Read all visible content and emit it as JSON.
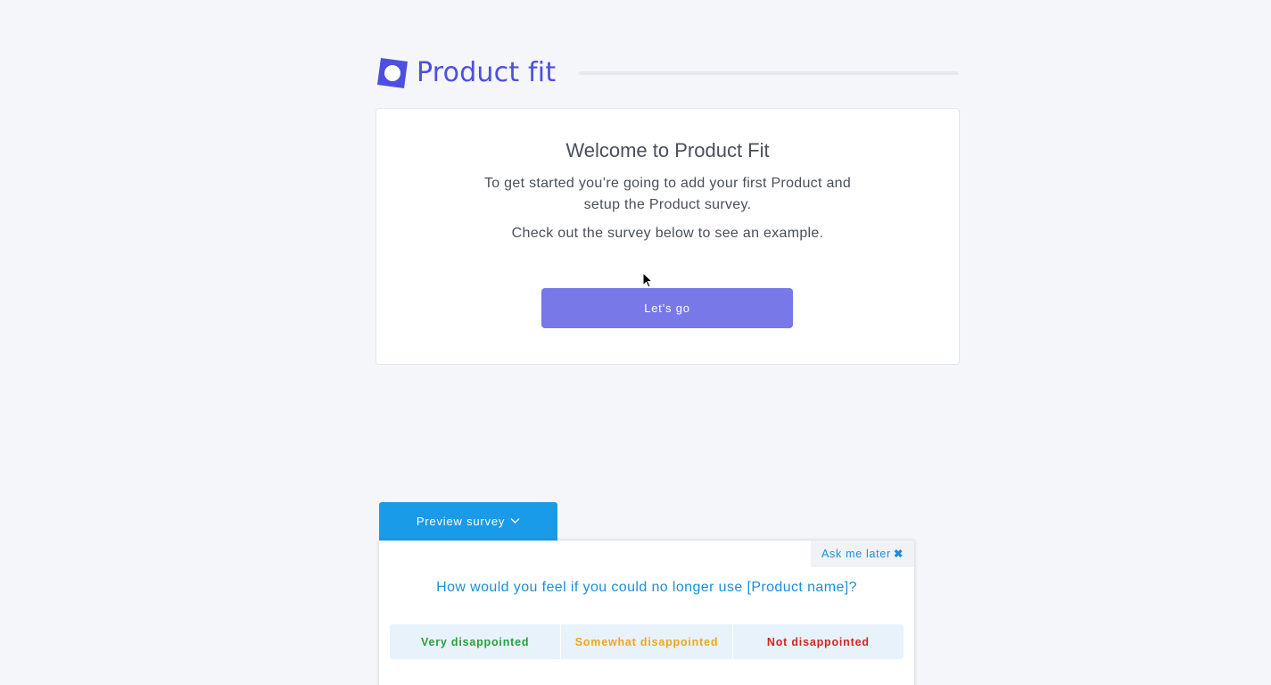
{
  "brand": {
    "name": "Product fit",
    "logo_icon": "product-fit-logo-icon",
    "color": "#4e4ee0"
  },
  "progress": {
    "value": 0.0
  },
  "welcome": {
    "title": "Welcome to Product Fit",
    "text": "To get started you’re going to add your first Product and setup the Product survey.",
    "text2": "Check out the survey below to see an example.",
    "button_label": "Let's go",
    "button_color": "#7878e8"
  },
  "survey": {
    "tab_label": "Preview survey",
    "tab_icon": "chevron-down-icon",
    "ask_later_label": "Ask me later",
    "ask_later_icon": "close-icon",
    "question": "How would you feel if you could no longer use [Product name]?",
    "options": [
      {
        "label": "Very disappointed",
        "color": "#23a339"
      },
      {
        "label": "Somewhat disappointed",
        "color": "#f2a51c"
      },
      {
        "label": "Not disappointed",
        "color": "#d4251f"
      }
    ]
  }
}
